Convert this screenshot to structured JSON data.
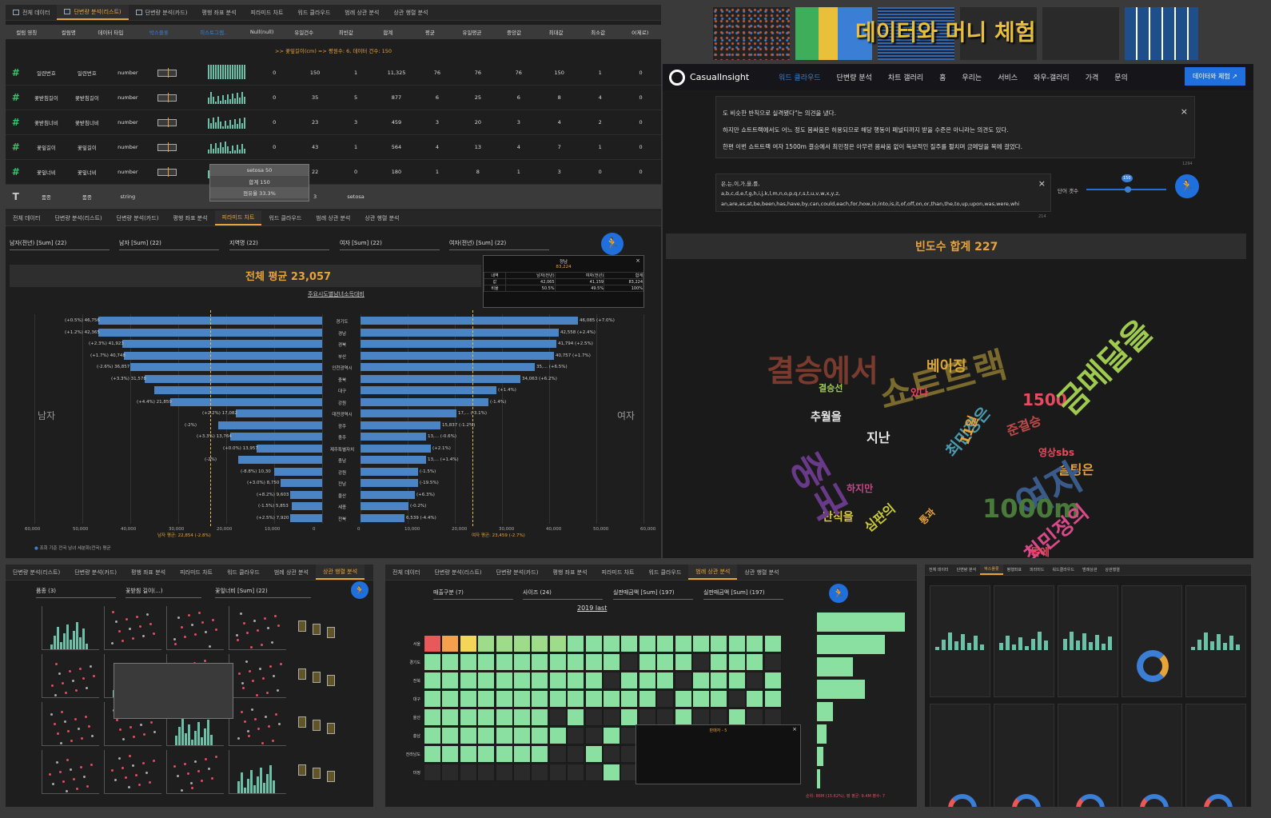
{
  "panel1": {
    "tabs": [
      "전체 데이터",
      "단변량 분석(리스트)",
      "단변량 분석(카드)",
      "평행 좌표 분석",
      "피라미드 차트",
      "워드 클라우드",
      "범례 상관 분석",
      "상관 행렬 분석"
    ],
    "columns": [
      "컬럼 영칭",
      "컬럼명",
      "데이터 타입",
      "박스플롯",
      "히스토그램..",
      "Null(null)",
      "유일건수",
      "최빈값",
      "합계",
      "평균",
      "유일평균",
      "중앙값",
      "최대값",
      "최소값",
      "0(제로)"
    ],
    "notice": ">> 꽃잎길이(cm) => 평원수: 6, 데이터 건수: 150",
    "rows": [
      {
        "en": "일련번호",
        "ko": "일련번호",
        "type": "number",
        "null": "0",
        "uniq": "150",
        "mode": "1",
        "sum": "11,325",
        "avg": "76",
        "uavg": "76",
        "med": "76",
        "max": "150",
        "min": "1",
        "zero": "0"
      },
      {
        "en": "꽃받침길이",
        "ko": "꽃받침길이",
        "type": "number",
        "null": "0",
        "uniq": "35",
        "mode": "5",
        "sum": "877",
        "avg": "6",
        "uavg": "25",
        "med": "6",
        "max": "8",
        "min": "4",
        "zero": "0"
      },
      {
        "en": "꽃받침너비",
        "ko": "꽃받침너비",
        "type": "number",
        "null": "0",
        "uniq": "23",
        "mode": "3",
        "sum": "459",
        "avg": "3",
        "uavg": "20",
        "med": "3",
        "max": "4",
        "min": "2",
        "zero": "0"
      },
      {
        "en": "꽃잎길이",
        "ko": "꽃잎길이",
        "type": "number",
        "null": "0",
        "uniq": "43",
        "mode": "1",
        "sum": "564",
        "avg": "4",
        "uavg": "13",
        "med": "4",
        "max": "7",
        "min": "1",
        "zero": "0"
      },
      {
        "en": "꽃잎너비",
        "ko": "꽃잎너비",
        "type": "number",
        "null": "0",
        "uniq": "22",
        "mode": "0",
        "sum": "180",
        "avg": "1",
        "uavg": "8",
        "med": "1",
        "max": "3",
        "min": "0",
        "zero": "0"
      },
      {
        "en": "품종",
        "ko": "품종",
        "type": "string",
        "null": "",
        "uniq": "3",
        "mode": "setosa",
        "sum": "",
        "avg": "",
        "uavg": "",
        "med": "",
        "max": "",
        "min": "",
        "zero": ""
      }
    ],
    "tooltip": [
      "setosa 50",
      "합계 150",
      "점유율 33.3%"
    ]
  },
  "panel2": {
    "tabs": [
      "전체 데이터",
      "단변량 분석(리스트)",
      "단변량 분석(카드)",
      "평행 좌표 분석",
      "피라미드 차트",
      "워드 클라우드",
      "범례 상관 분석",
      "상관 행렬 분석"
    ],
    "selectors": [
      "남자(전년) [Sum] (22)",
      "남자 [Sum] (22)",
      "지역명 (22)",
      "여자 [Sum] (22)",
      "여자(전년) [Sum] (22)"
    ],
    "big_title": "전체 평균 23,057",
    "subtitle": "주요시도별남녀소득대비",
    "left_label": "남자",
    "right_label": "여자",
    "popup": {
      "title": "정남",
      "value": "83,224",
      "head": [
        "내역",
        "남자(전년)",
        "여자(전년)",
        "합계"
      ],
      "r1": [
        "값",
        "42,065",
        "41,159",
        "83,224"
      ],
      "r2": [
        "비율",
        "50.5%",
        "49.5%",
        "100%"
      ]
    },
    "regions": [
      "경기도",
      "경남",
      "경북",
      "부산",
      "인천광역시",
      "충북",
      "대구",
      "강원",
      "대전광역시",
      "광주",
      "충주",
      "제주특별자치",
      "충남",
      "강원",
      "전남",
      "울산",
      "세종",
      "전북"
    ],
    "left_labels": [
      "(+0.5%) 46,756",
      "(+1.2%) 42,365",
      "(+2.3%) 41,923",
      "(+1.7%) 40,748",
      "(-2.6%) 36,857",
      "(+3.3%) 31,578",
      "",
      "(+4.4%) 21,859",
      "(+2.2%) 17,082",
      "(-2%)",
      "(+3.3%) 13,764",
      "(+0.0%) 13,957",
      "(-2%)",
      "(-8.8%) 10,30",
      "(+3.0%) 8,750",
      "(+8.2%) 9,603",
      "(-1.5%) 5,853",
      "(+2.5%) 7,920"
    ],
    "right_labels": [
      "46,085 (+7.0%)",
      "42,558 (+2.4%)",
      "41,794 (+2.5%)",
      "40,757 (+1.7%)",
      "35,... (+6.5%)",
      "34,063 (+6.2%)",
      "(+1.4%)",
      "(-1.4%)",
      "17,... (-3.1%)",
      "15,837 (-1.2%)",
      "13,... (-0.6%)",
      "(+2.1%)",
      "13,... (+1.4%)",
      "(-1.5%)",
      "(-19.5%)",
      "(+6.3%)",
      "(-0.2%)",
      "6,539 (-4.4%)"
    ],
    "axis_left": [
      "60,000",
      "50,000",
      "40,000",
      "30,000",
      "20,000",
      "10,000",
      "0"
    ],
    "axis_right": [
      "0",
      "10,000",
      "20,000",
      "30,000",
      "40,000",
      "50,000",
      "60,000"
    ],
    "avg_left": "남자 평균: 22,854 (-2.8%)",
    "avg_right": "여자 평균: 23,459 (-2.7%)",
    "footnote": "조회 기준 전국 남녀 세분화(전국) 평균"
  },
  "thumbs": {
    "title": "데이터와 머니 체험"
  },
  "site": {
    "brand": "CasualInsight",
    "nav": [
      "워드 클라우드",
      "단변량 분석",
      "차트 갤러리",
      "홈",
      "우리는",
      "서비스",
      "와우-갤러리",
      "가격",
      "문의"
    ],
    "cta": "데이터와 체험",
    "textarea_lines": [
      "도 비슷한 반칙으로 실격됐다\"는 의견을 냈다.",
      "하지만 쇼트트랙에서도 어느 정도 몸싸움은 허용되므로 해당 행동이 페널티까지 받을 수준은 아니라는 의견도 있다.",
      "한편 이번 쇼트트랙 여자 1500m 결승에서 최민정은 아무런 몸싸움 없이 독보적인 질주를 펼치며 금메달을 목에 걸었다."
    ],
    "stop_words_lines": [
      "은,는,이,가,을,를,",
      "a,b,c,d,e,f,g,h,i,j,k,l,m,n,o,p,q,r,s,t,u,v,w,x,y,z,",
      "an,are,as,at,be,been,has,have,by,can,could,each,for,how,in,into,is,it,of,off,on,or,than,the,to,up,upon,was,were,whi"
    ],
    "count1": "1294",
    "count2": "214",
    "slider_label": "단어 갯수",
    "slider_value": "150",
    "freq": "빈도수 합계 227"
  },
  "words": [
    {
      "t": "결승에서",
      "c": "#7a3b2e"
    },
    {
      "t": "쇼트트랙",
      "c": "#7a6a2e"
    },
    {
      "t": "베이징",
      "c": "#d9a53a"
    },
    {
      "t": "1500",
      "c": "#e84a5f"
    },
    {
      "t": "금메달을",
      "c": "#9ecb4f"
    },
    {
      "t": "영상sbs",
      "c": "#e84a5f"
    },
    {
      "t": "슬팅은",
      "c": "#e8a33a"
    },
    {
      "t": "여자",
      "c": "#3a5a8a"
    },
    {
      "t": "1000m",
      "c": "#4a7a3a"
    },
    {
      "t": "최민정의",
      "c": "#d94a8a"
    },
    {
      "t": "목에",
      "c": "#e84a5f"
    },
    {
      "t": "나쁜",
      "c": "#d94a8a"
    },
    {
      "t": "반칙을",
      "c": "#d9c83a"
    },
    {
      "t": "추월을",
      "c": "#e8e8e8"
    },
    {
      "t": "결승선",
      "c": "#9ecb4f"
    },
    {
      "t": "중국",
      "c": "#6a3a8a"
    },
    {
      "t": "지난",
      "c": "#e8e8e8"
    },
    {
      "t": "최민정은",
      "c": "#4a9ab0"
    },
    {
      "t": "하지만",
      "c": "#c04a8a"
    },
    {
      "t": "통과",
      "c": "#e8a33a"
    },
    {
      "t": "있다",
      "c": "#e84a5f"
    },
    {
      "t": "심판의",
      "c": "#c9c93a"
    },
    {
      "t": "11일",
      "c": "#e8a33a"
    },
    {
      "t": "준결승",
      "c": "#c04a4a"
    }
  ],
  "panel4": {
    "tabs": [
      "단변량 분석(리스트)",
      "단변량 분석(카드)",
      "평행 좌표 분석",
      "피라미드 차트",
      "워드 클라우드",
      "범례 상관 분석",
      "상관 행렬 분석"
    ],
    "selectors": [
      "품종 (3)",
      "꽃받침 길이(...)",
      "꽃잎너비 [Sum] (22)"
    ]
  },
  "panel5": {
    "tabs": [
      "전체 데이터",
      "단변량 분석(리스트)",
      "단변량 분석(카드)",
      "평행 좌표 분석",
      "피라미드 차트",
      "워드 클라우드",
      "범례 상관 분석",
      "상관 행렬 분석"
    ],
    "selectors": [
      "매출구분 (7)",
      "사이즈 (24)",
      "실판매금액 [Sum] (197)",
      "실판매금액 [Sum] (197)"
    ],
    "chart_title": "2019 last",
    "row_labels": [
      "서울",
      "경기도",
      "전북",
      "대구",
      "울산",
      "충남",
      "전라남도",
      "미정"
    ],
    "popup_title": "판매자 - 5",
    "footer": "순위: 86M (15.62%), 평 평균: 9.4M 평수: 7"
  },
  "panel6": {
    "tabs": [
      "전체 데이터",
      "단변량 분석",
      "박스플롯",
      "평행좌표",
      "피라미드",
      "워드클라우드",
      "범례상관",
      "상관행렬"
    ]
  }
}
